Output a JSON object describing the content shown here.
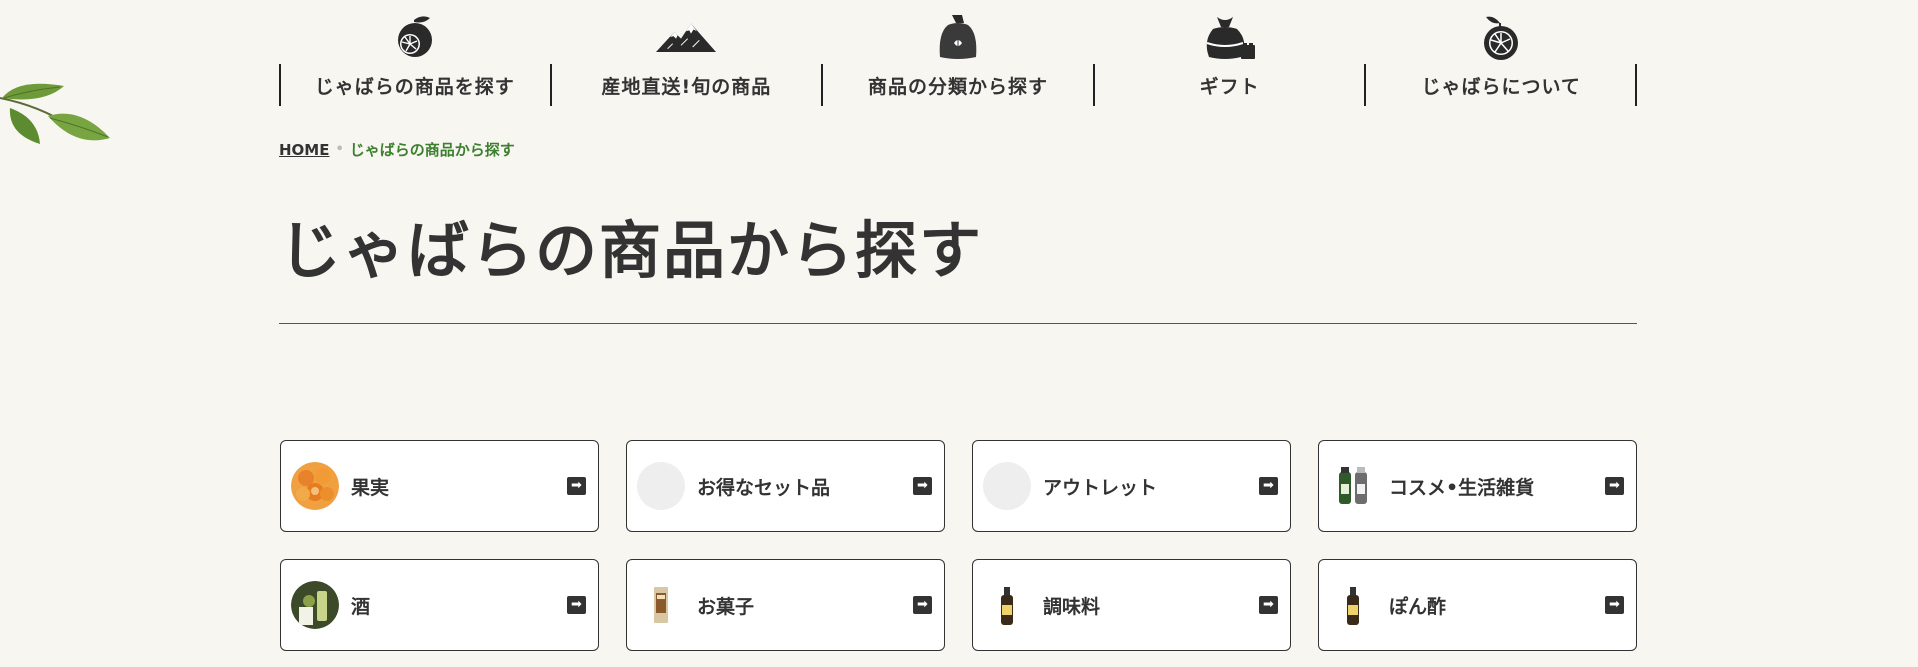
{
  "nav": {
    "items": [
      {
        "label": "じゃばらの商品を探す",
        "icon": "citrus-fruit-icon"
      },
      {
        "label": "産地直送!旬の商品",
        "icon": "mountain-icon"
      },
      {
        "label": "商品の分類から探す",
        "icon": "sack-icon"
      },
      {
        "label": "ギフト",
        "icon": "gift-bag-icon"
      },
      {
        "label": "じゃばらについて",
        "icon": "citrus-slice-icon"
      }
    ]
  },
  "breadcrumb": {
    "home": "HOME",
    "separator": "•",
    "current": "じゃばらの商品から探す"
  },
  "page": {
    "title": "じゃばらの商品から探す"
  },
  "categories": [
    {
      "label": "果実",
      "thumb": "orange-fruit-photo"
    },
    {
      "label": "お得なセット品",
      "thumb": "placeholder-circle"
    },
    {
      "label": "アウトレット",
      "thumb": "placeholder-circle"
    },
    {
      "label": "コスメ•生活雑貨",
      "thumb": "cosmetics-bottles-photo"
    },
    {
      "label": "酒",
      "thumb": "liquor-photo"
    },
    {
      "label": "お菓子",
      "thumb": "snack-package-photo"
    },
    {
      "label": "調味料",
      "thumb": "seasoning-bottle-photo"
    },
    {
      "label": "ぽん酢",
      "thumb": "ponzu-bottle-photo"
    }
  ],
  "colors": {
    "background": "#f8f6f1",
    "text": "#333333",
    "breadcrumb_current": "#3b7f2f",
    "card_border": "#333333"
  }
}
